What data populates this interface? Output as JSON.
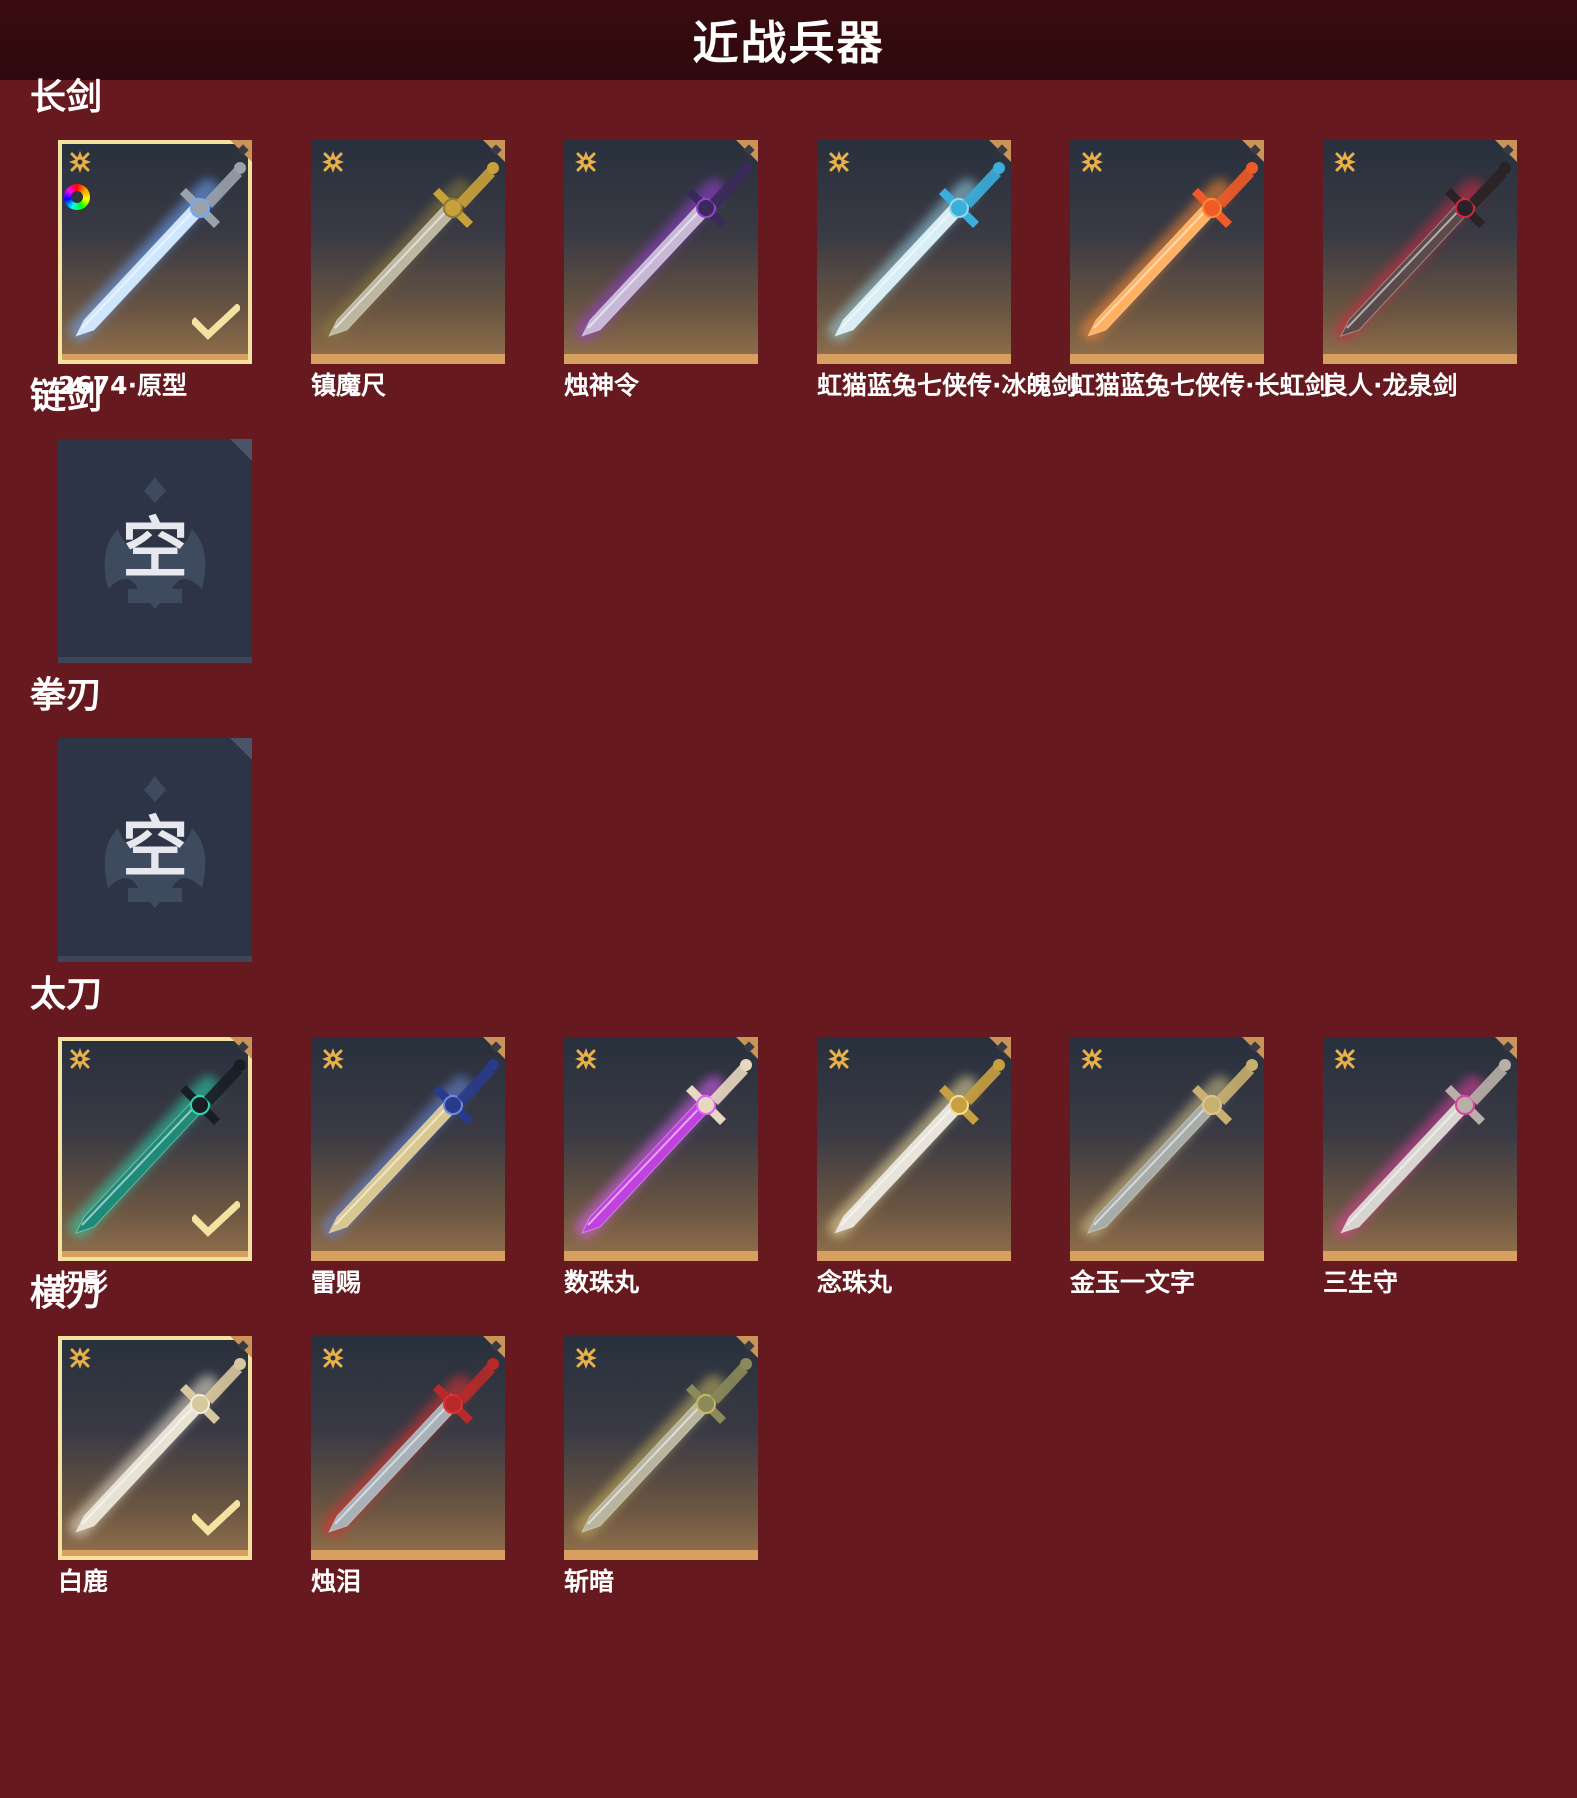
{
  "header": {
    "title": "近战兵器"
  },
  "sections": [
    {
      "title": "长剑",
      "items": [
        {
          "label": "2674·原型",
          "selected": true,
          "color_wheel": true,
          "blade": "#cfe6ff",
          "hilt": "#9aa2ad",
          "glow": "#6fa8ff"
        },
        {
          "label": "镇魔尺",
          "selected": false,
          "blade": "#bdb6a0",
          "hilt": "#c9a13b",
          "glow": "#8c7a3a"
        },
        {
          "label": "烛神令",
          "selected": false,
          "blade": "#c8b8d8",
          "hilt": "#3a2a5a",
          "glow": "#9a40d8"
        },
        {
          "label": "虹猫蓝兔七侠传·冰魄剑",
          "selected": false,
          "blade": "#d8eef4",
          "hilt": "#3aaedc",
          "glow": "#9ad8ec"
        },
        {
          "label": "虹猫蓝兔七侠传·长虹剑",
          "selected": false,
          "blade": "#ffb060",
          "hilt": "#f05a28",
          "glow": "#ff8a30"
        },
        {
          "label": "良人·龙泉剑",
          "selected": false,
          "blade": "#5a4a4a",
          "hilt": "#2a2226",
          "glow": "#d02a40"
        }
      ]
    },
    {
      "title": "链剑",
      "empty_label": "空"
    },
    {
      "title": "拳刃",
      "empty_label": "空"
    },
    {
      "title": "太刀",
      "items": [
        {
          "label": "切影",
          "selected": true,
          "blade": "#1e8a78",
          "hilt": "#1a1e24",
          "glow": "#2ad8b0"
        },
        {
          "label": "雷赐",
          "selected": false,
          "blade": "#d8c890",
          "hilt": "#2a3a8a",
          "glow": "#6a8ae0"
        },
        {
          "label": "数珠丸",
          "selected": false,
          "blade": "#c040e0",
          "hilt": "#e8d8c0",
          "glow": "#e060ff"
        },
        {
          "label": "念珠丸",
          "selected": false,
          "blade": "#e8e4dc",
          "hilt": "#c8a040",
          "glow": "#f0e0a0"
        },
        {
          "label": "金玉一文字",
          "selected": false,
          "blade": "#a8aca8",
          "hilt": "#c8b070",
          "glow": "#d8c890"
        },
        {
          "label": "三生守",
          "selected": false,
          "blade": "#d8d4d0",
          "hilt": "#b8b0a8",
          "glow": "#e040a0"
        }
      ]
    },
    {
      "title": "横刀",
      "items": [
        {
          "label": "白鹿",
          "selected": true,
          "blade": "#e8e2d4",
          "hilt": "#d8c8a0",
          "glow": "#f4ecd8"
        },
        {
          "label": "烛泪",
          "selected": false,
          "blade": "#a8b0b8",
          "hilt": "#b82a2a",
          "glow": "#e03030"
        },
        {
          "label": "斩暗",
          "selected": false,
          "blade": "#b8b4a0",
          "hilt": "#8a8a5a",
          "glow": "#c8b860"
        }
      ]
    }
  ],
  "colors": {
    "background": "#661a1f",
    "header_bg": "#2e090d",
    "card_bottom_bar": "#d8a060",
    "selected_border": "#f4e2a0",
    "rarity_icon": "#e8b048",
    "empty_card_bg": "#2d3446"
  },
  "icons": {
    "rarity": "four-point-star-icon",
    "equipped": "checkmark-icon",
    "dye": "color-wheel-icon",
    "empty": "empty-slot-emblem-icon"
  }
}
